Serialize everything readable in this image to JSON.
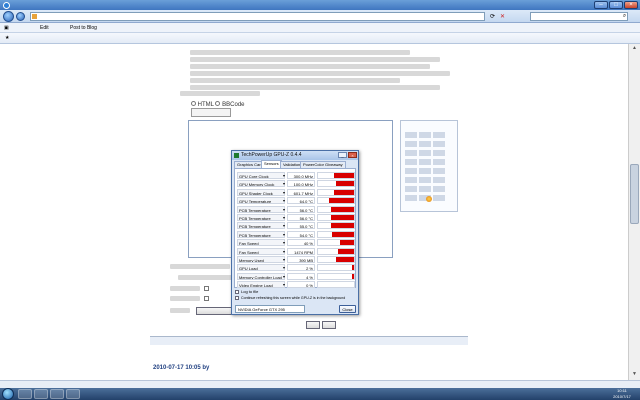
{
  "browser": {
    "title": "",
    "address": "",
    "search_placeholder": ""
  },
  "toolbar": {
    "edit": "Edit",
    "post_to_blog": "Post to Blog"
  },
  "favbar": {
    "items": [
      "",
      ""
    ],
    "commands": [
      "",
      ""
    ]
  },
  "editor": {
    "format_html": "HTML",
    "format_bbcode": "BBCode",
    "content_lines": [
      "",
      "",
      ""
    ]
  },
  "emoji": {
    "title": ""
  },
  "form": {
    "submit": "",
    "preview": ""
  },
  "reply": {
    "header": "",
    "meta": "",
    "line1": "",
    "line2": "",
    "date": "2010-07-17 10:05 by"
  },
  "gpuz": {
    "title": "TechPowerUp GPU-Z 0.4.4",
    "tabs": [
      "Graphics Card",
      "Sensors",
      "Validation",
      "PowerColor Giveaway"
    ],
    "active_tab": 1,
    "sensors": [
      {
        "name": "GPU Core Clock",
        "value": "300.0 MHz",
        "level": 0.55
      },
      {
        "name": "GPU Memory Clock",
        "value": "100.0 MHz",
        "level": 0.5
      },
      {
        "name": "GPU Shader Clock",
        "value": "601.7 MHz",
        "level": 0.55
      },
      {
        "name": "GPU Temperature",
        "value": "64.0 °C",
        "level": 0.7
      },
      {
        "name": "PCB Temperature",
        "value": "56.0 °C",
        "level": 0.65
      },
      {
        "name": "PCB Temperature",
        "value": "56.0 °C",
        "level": 0.65
      },
      {
        "name": "PCB Temperature",
        "value": "55.0 °C",
        "level": 0.65
      },
      {
        "name": "PCB Temperature",
        "value": "54.0 °C",
        "level": 0.6
      },
      {
        "name": "Fan Speed",
        "value": "40 %",
        "level": 0.4
      },
      {
        "name": "Fan Speed",
        "value": "1474 RPM",
        "level": 0.45
      },
      {
        "name": "Memory Used",
        "value": "390 MB",
        "level": 0.5
      },
      {
        "name": "GPU Load",
        "value": "2 %",
        "level": 0.05
      },
      {
        "name": "Memory Controller Load",
        "value": "4 %",
        "level": 0.06
      },
      {
        "name": "Video Engine Load",
        "value": "0 %",
        "level": 0.0
      }
    ],
    "log_label": "Log to file",
    "continue_label": "Continue refreshing this screen while GPU-Z is in the background",
    "device": "NVIDIA GeForce GTX 295",
    "close_label": "Close"
  },
  "status": {
    "zone": "",
    "zoom": ""
  },
  "clock": {
    "time": "10:11",
    "date": "2010/7/17"
  }
}
